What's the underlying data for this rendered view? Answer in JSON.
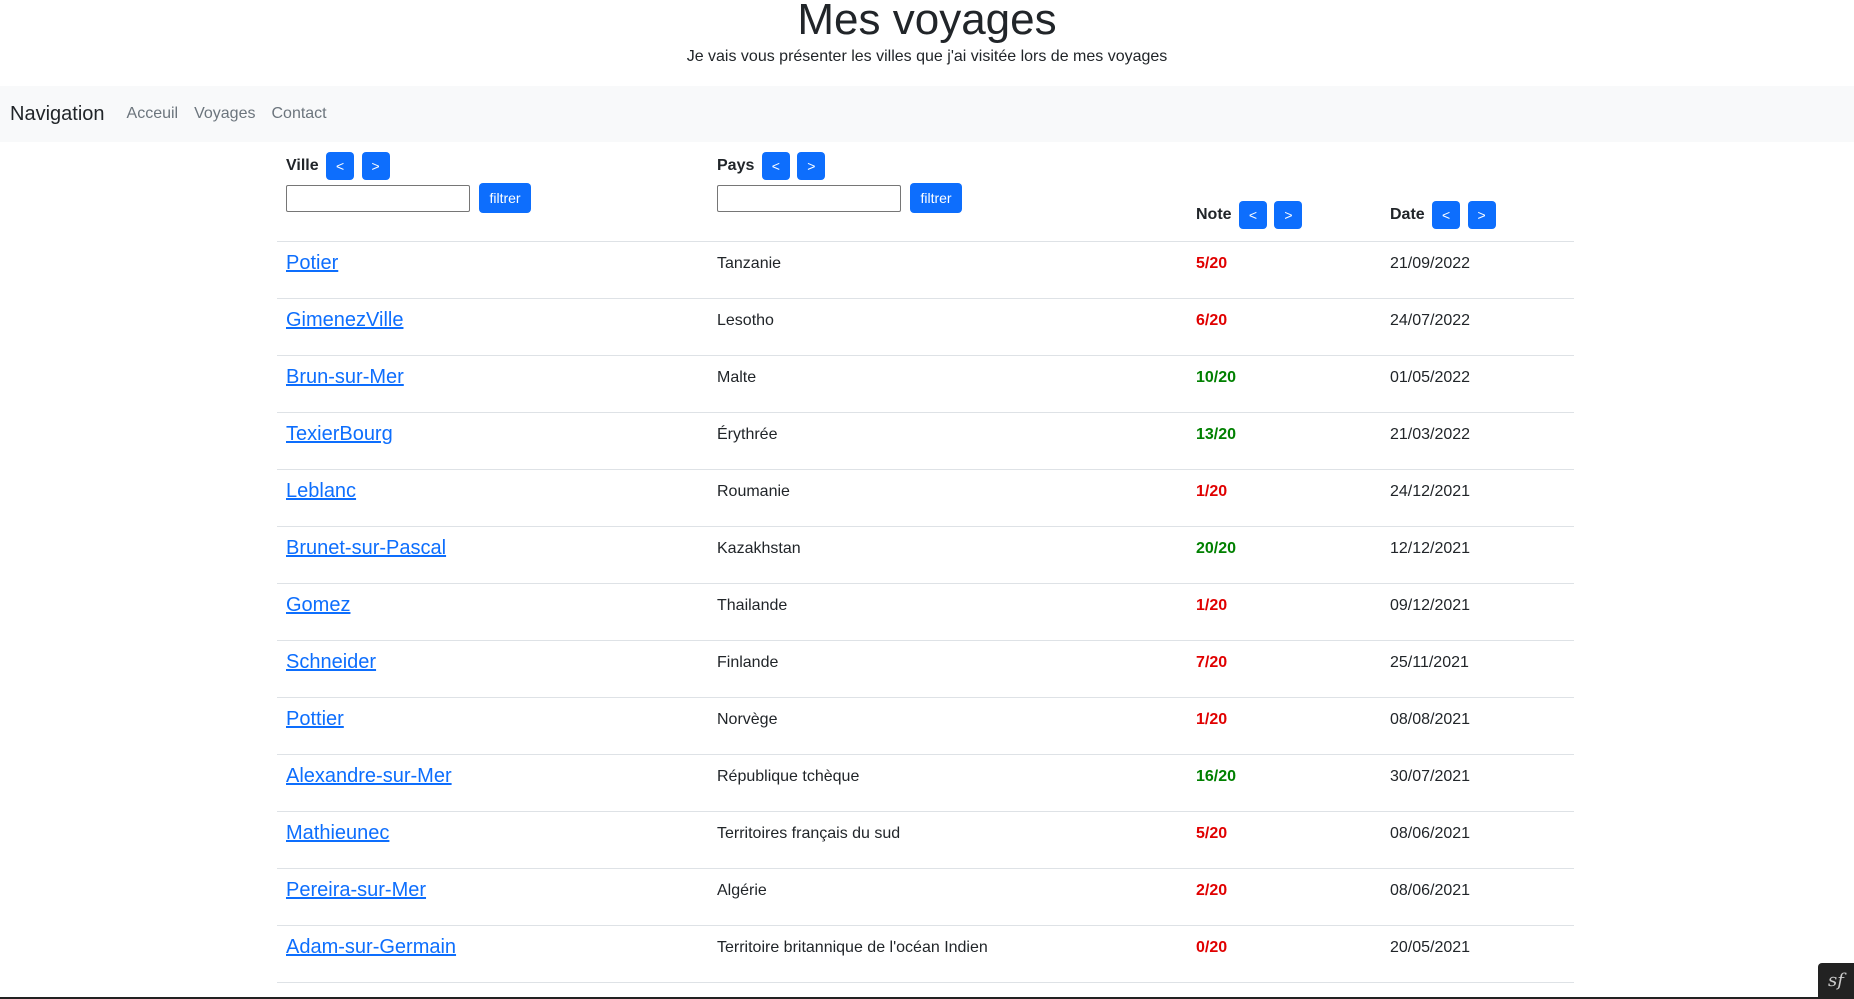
{
  "header": {
    "title": "Mes voyages",
    "subtitle": "Je vais vous présenter les villes que j'ai visitée lors de mes voyages"
  },
  "nav": {
    "brand": "Navigation",
    "links": [
      "Acceuil",
      "Voyages",
      "Contact"
    ]
  },
  "table": {
    "headers": {
      "ville": "Ville",
      "pays": "Pays",
      "note": "Note",
      "date": "Date"
    },
    "sort_prev": "<",
    "sort_next": ">",
    "filter_label": "filtrer",
    "rows": [
      {
        "ville": "Potier",
        "pays": "Tanzanie",
        "note": "5/20",
        "date": "21/09/2022"
      },
      {
        "ville": "GimenezVille",
        "pays": "Lesotho",
        "note": "6/20",
        "date": "24/07/2022"
      },
      {
        "ville": "Brun-sur-Mer",
        "pays": "Malte",
        "note": "10/20",
        "date": "01/05/2022"
      },
      {
        "ville": "TexierBourg",
        "pays": "Érythrée",
        "note": "13/20",
        "date": "21/03/2022"
      },
      {
        "ville": "Leblanc",
        "pays": "Roumanie",
        "note": "1/20",
        "date": "24/12/2021"
      },
      {
        "ville": "Brunet-sur-Pascal",
        "pays": "Kazakhstan",
        "note": "20/20",
        "date": "12/12/2021"
      },
      {
        "ville": "Gomez",
        "pays": "Thailande",
        "note": "1/20",
        "date": "09/12/2021"
      },
      {
        "ville": "Schneider",
        "pays": "Finlande",
        "note": "7/20",
        "date": "25/11/2021"
      },
      {
        "ville": "Pottier",
        "pays": "Norvège",
        "note": "1/20",
        "date": "08/08/2021"
      },
      {
        "ville": "Alexandre-sur-Mer",
        "pays": "République tchèque",
        "note": "16/20",
        "date": "30/07/2021"
      },
      {
        "ville": "Mathieunec",
        "pays": "Territoires français du sud",
        "note": "5/20",
        "date": "08/06/2021"
      },
      {
        "ville": "Pereira-sur-Mer",
        "pays": "Algérie",
        "note": "2/20",
        "date": "08/06/2021"
      },
      {
        "ville": "Adam-sur-Germain",
        "pays": "Territoire britannique de l'océan Indien",
        "note": "0/20",
        "date": "20/05/2021"
      }
    ]
  },
  "colors": {
    "note_low": "#e00000",
    "note_high": "#008000",
    "accent": "#0d6efd"
  },
  "icons": {
    "corner": "symfony-logo-icon"
  }
}
